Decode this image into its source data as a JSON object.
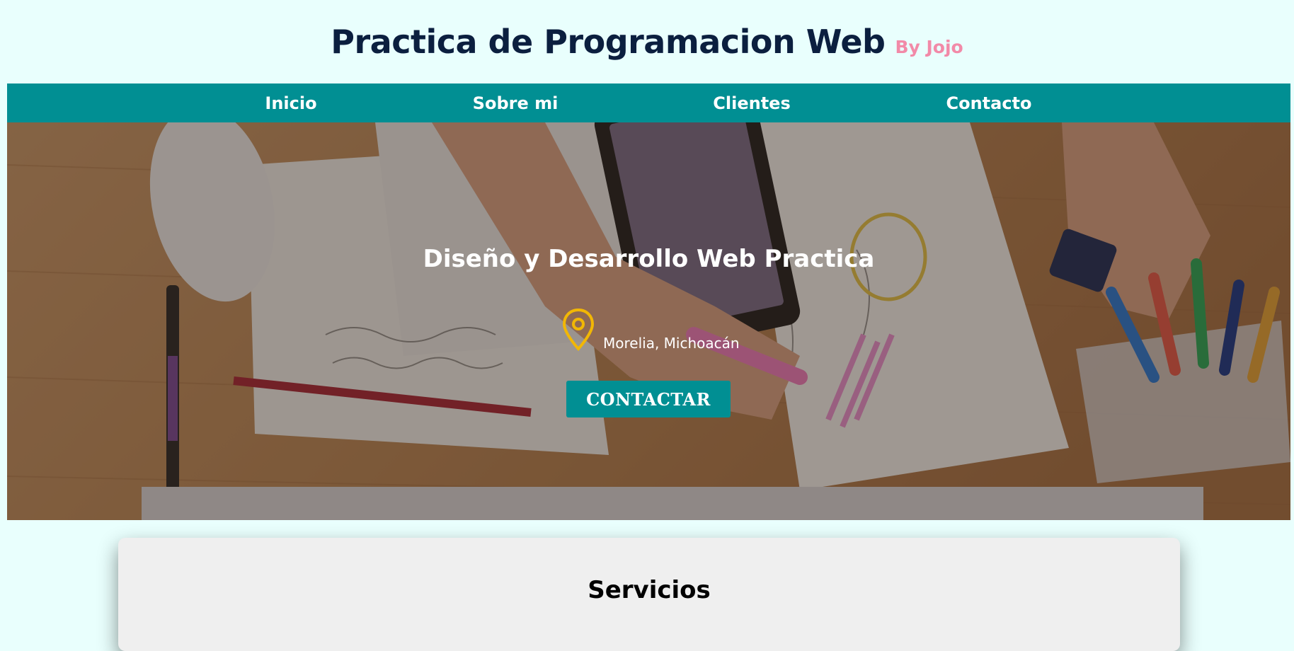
{
  "header": {
    "title": "Practica de Programacion Web",
    "author": "By Jojo"
  },
  "nav": {
    "items": [
      {
        "label": "Inicio"
      },
      {
        "label": "Sobre mi"
      },
      {
        "label": "Clientes"
      },
      {
        "label": "Contacto"
      }
    ]
  },
  "hero": {
    "title": "Diseño y Desarrollo Web Practica",
    "location": "Morelia, Michoacán",
    "button_label": "CONTACTAR",
    "background_image": "desk with hands sketching on papers, phone, mouse and markers"
  },
  "services": {
    "title": "Servicios"
  },
  "colors": {
    "page_background": "#e9fffd",
    "title": "#0b1f3f",
    "author": "#f28aa8",
    "nav_background": "#018f93",
    "pin_icon": "#f2b705",
    "card_background": "#efefef"
  },
  "icons": {
    "location": "map-pin-icon"
  }
}
